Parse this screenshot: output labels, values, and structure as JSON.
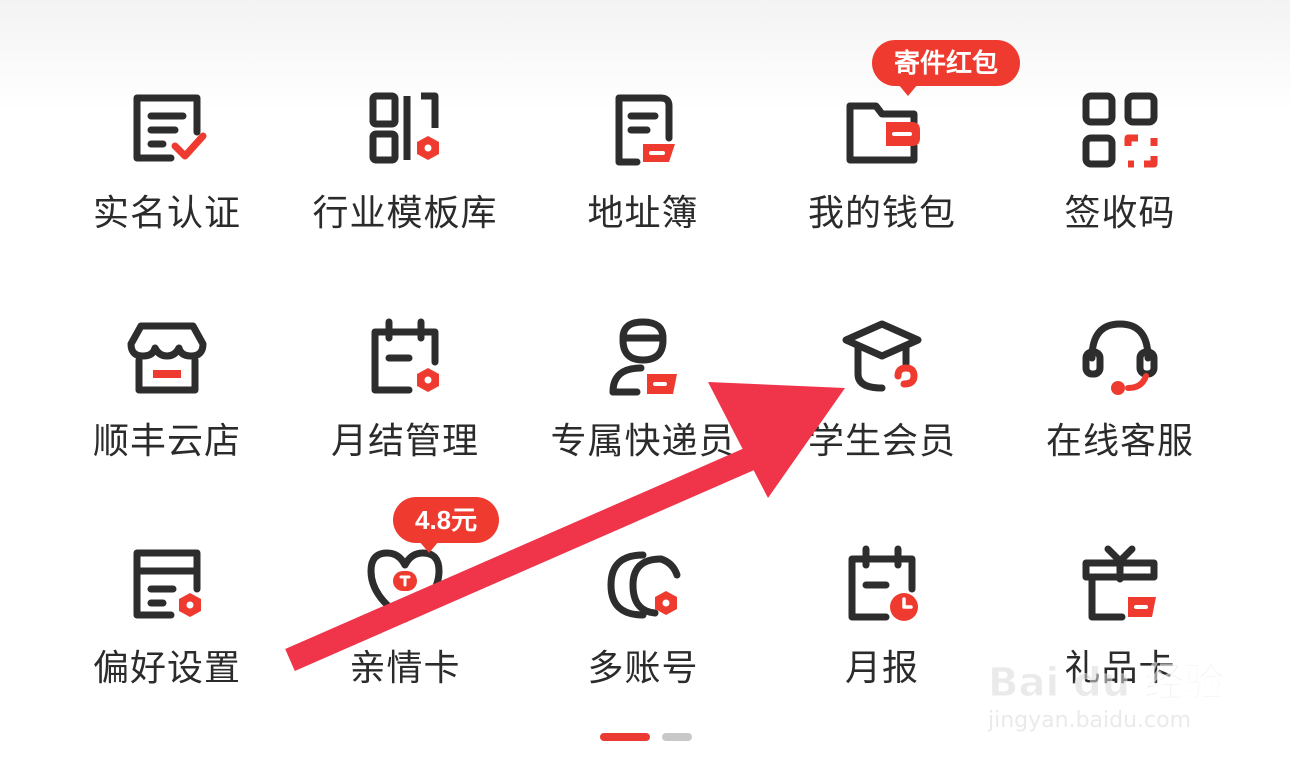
{
  "colors": {
    "accent": "#ef3b2f",
    "icon": "#2d2d2d",
    "arrow": "#f0344a"
  },
  "grid": {
    "items": [
      {
        "label": "实名认证",
        "icon": "id-check-icon"
      },
      {
        "label": "行业模板库",
        "icon": "template-library-icon"
      },
      {
        "label": "地址簿",
        "icon": "address-book-icon"
      },
      {
        "label": "我的钱包",
        "icon": "wallet-icon",
        "badge": "寄件红包"
      },
      {
        "label": "签收码",
        "icon": "qr-code-icon"
      },
      {
        "label": "顺丰云店",
        "icon": "store-icon"
      },
      {
        "label": "月结管理",
        "icon": "monthly-billing-icon"
      },
      {
        "label": "专属快递员",
        "icon": "courier-icon"
      },
      {
        "label": "学生会员",
        "icon": "graduation-cap-icon"
      },
      {
        "label": "在线客服",
        "icon": "headset-icon"
      },
      {
        "label": "偏好设置",
        "icon": "preferences-icon"
      },
      {
        "label": "亲情卡",
        "icon": "family-card-icon",
        "badge": "4.8元"
      },
      {
        "label": "多账号",
        "icon": "multi-account-icon"
      },
      {
        "label": "月报",
        "icon": "monthly-report-icon"
      },
      {
        "label": "礼品卡",
        "icon": "gift-card-icon"
      }
    ]
  },
  "pagination": {
    "current_page": 1,
    "total_pages": 2
  },
  "watermark": {
    "brand": "Bai du 经验",
    "url": "jingyan.baidu.com"
  }
}
